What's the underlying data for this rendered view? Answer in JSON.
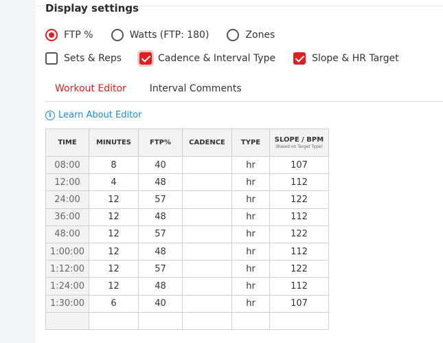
{
  "settings": {
    "title": "Display settings",
    "display_mode": [
      {
        "label": "FTP %",
        "checked": true
      },
      {
        "label": "Watts (FTP: 180)",
        "checked": false
      },
      {
        "label": "Zones",
        "checked": false
      }
    ],
    "options": [
      {
        "label": "Sets & Reps",
        "checked": false
      },
      {
        "label": "Cadence & Interval Type",
        "checked": true
      },
      {
        "label": "Slope & HR Target",
        "checked": true
      }
    ]
  },
  "tabs": [
    {
      "label": "Workout Editor",
      "active": true
    },
    {
      "label": "Interval Comments",
      "active": false
    }
  ],
  "learn_link": "Learn About Editor",
  "table": {
    "headers": {
      "time": "TIME",
      "minutes": "MINUTES",
      "ftp": "FTP%",
      "cadence": "CADENCE",
      "type": "TYPE",
      "slope": "SLOPE / BPM",
      "slope_sub": "(Based on Target Type)"
    },
    "rows": [
      {
        "time": "08:00",
        "minutes": "8",
        "ftp": "40",
        "cadence": "",
        "type": "hr",
        "slope": "107"
      },
      {
        "time": "12:00",
        "minutes": "4",
        "ftp": "48",
        "cadence": "",
        "type": "hr",
        "slope": "112"
      },
      {
        "time": "24:00",
        "minutes": "12",
        "ftp": "57",
        "cadence": "",
        "type": "hr",
        "slope": "122"
      },
      {
        "time": "36:00",
        "minutes": "12",
        "ftp": "48",
        "cadence": "",
        "type": "hr",
        "slope": "112"
      },
      {
        "time": "48:00",
        "minutes": "12",
        "ftp": "57",
        "cadence": "",
        "type": "hr",
        "slope": "122"
      },
      {
        "time": "1:00:00",
        "minutes": "12",
        "ftp": "48",
        "cadence": "",
        "type": "hr",
        "slope": "112"
      },
      {
        "time": "1:12:00",
        "minutes": "12",
        "ftp": "57",
        "cadence": "",
        "type": "hr",
        "slope": "122"
      },
      {
        "time": "1:24:00",
        "minutes": "12",
        "ftp": "48",
        "cadence": "",
        "type": "hr",
        "slope": "112"
      },
      {
        "time": "1:30:00",
        "minutes": "6",
        "ftp": "40",
        "cadence": "",
        "type": "hr",
        "slope": "107"
      },
      {
        "time": "",
        "minutes": "",
        "ftp": "",
        "cadence": "",
        "type": "",
        "slope": ""
      }
    ]
  },
  "colors": {
    "accent": "#e02020",
    "link": "#1f88d8",
    "header_bg": "#f3f3f3",
    "gutter_bg": "#f4f5f7"
  }
}
